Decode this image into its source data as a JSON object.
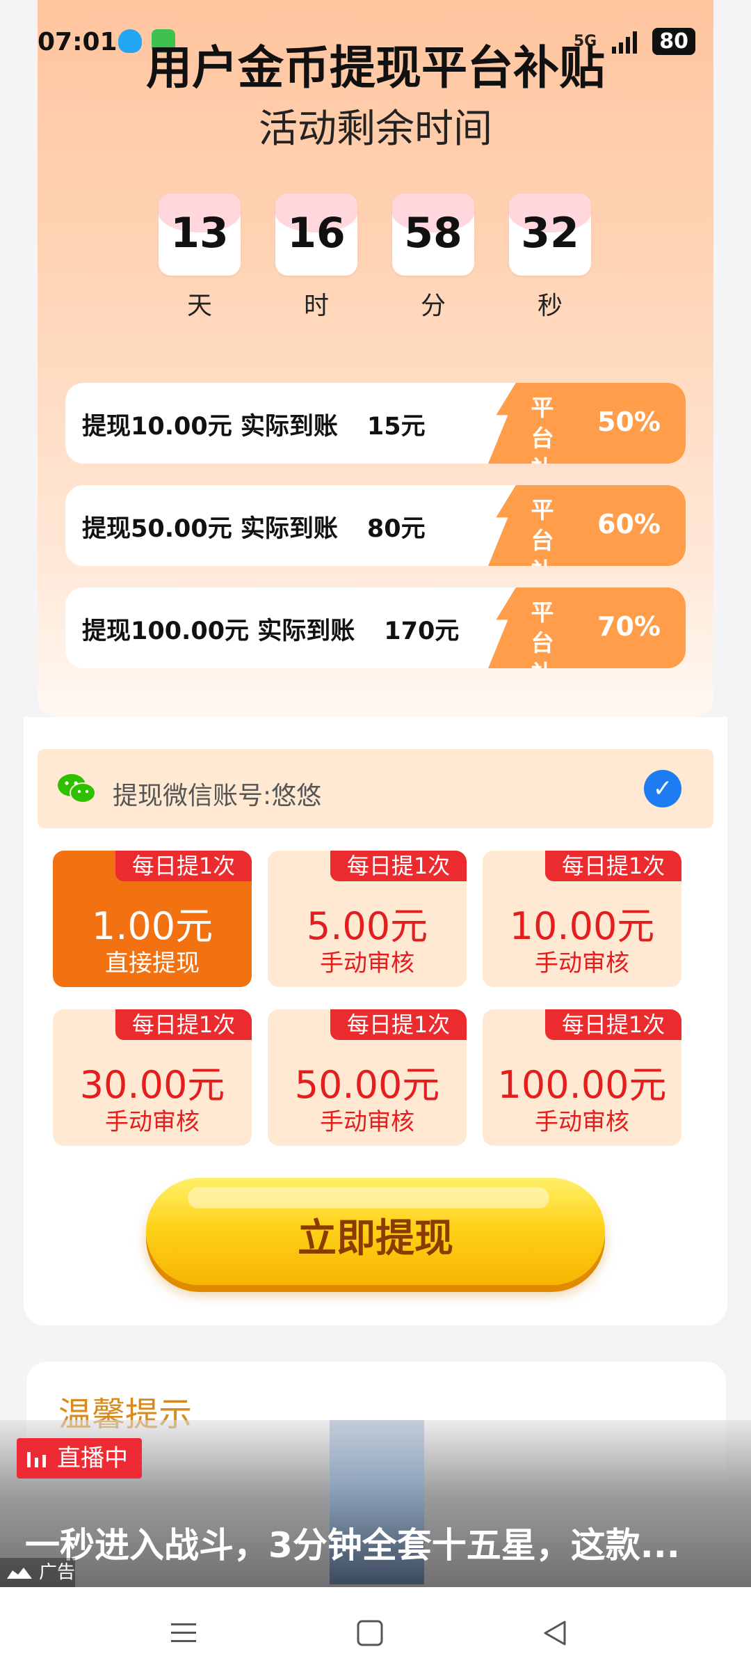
{
  "status_bar": {
    "time": "07:01",
    "network": "5G",
    "battery": "80"
  },
  "header": {
    "title": "用户金币提现平台补贴",
    "subtitle": "活动剩余时间"
  },
  "countdown": [
    {
      "value": "13",
      "unit": "天"
    },
    {
      "value": "16",
      "unit": "时"
    },
    {
      "value": "58",
      "unit": "分"
    },
    {
      "value": "32",
      "unit": "秒"
    }
  ],
  "tiers": [
    {
      "text": "提现10.00元 实际到账",
      "amount": "15元",
      "tag": "平台补贴",
      "percent": "50%"
    },
    {
      "text": "提现50.00元 实际到账",
      "amount": "80元",
      "tag": "平台补贴",
      "percent": "60%"
    },
    {
      "text": "提现100.00元 实际到账",
      "amount": "170元",
      "tag": "平台补贴",
      "percent": "70%"
    }
  ],
  "wechat": {
    "label": "提现微信账号:悠悠"
  },
  "options": [
    {
      "badge": "每日提1次",
      "amount": "1.00元",
      "desc": "直接提现",
      "active": true
    },
    {
      "badge": "每日提1次",
      "amount": "5.00元",
      "desc": "手动审核",
      "active": false
    },
    {
      "badge": "每日提1次",
      "amount": "10.00元",
      "desc": "手动审核",
      "active": false
    },
    {
      "badge": "每日提1次",
      "amount": "30.00元",
      "desc": "手动审核",
      "active": false
    },
    {
      "badge": "每日提1次",
      "amount": "50.00元",
      "desc": "手动审核",
      "active": false
    },
    {
      "badge": "每日提1次",
      "amount": "100.00元",
      "desc": "手动审核",
      "active": false
    }
  ],
  "withdraw_button": "立即提现",
  "tips": {
    "title": "温馨提示"
  },
  "ad": {
    "live_badge": "直播中",
    "title": "一秒进入战斗，3分钟全套十五星，这款...",
    "label": "广告"
  },
  "colors": {
    "accent": "#f27212",
    "badge_red": "#ec2b2f",
    "button_yellow": "#ffd21a"
  }
}
